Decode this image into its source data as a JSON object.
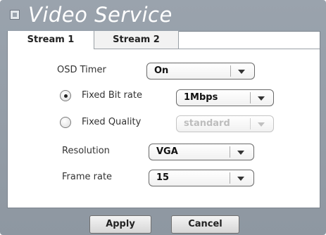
{
  "window": {
    "title": "Video Service"
  },
  "tabs": [
    {
      "label": "Stream 1",
      "active": true
    },
    {
      "label": "Stream 2",
      "active": false
    }
  ],
  "form": {
    "osd_timer": {
      "label": "OSD Timer",
      "value": "On"
    },
    "bitrate_mode": {
      "fixed_bit_rate": {
        "label": "Fixed Bit rate",
        "selected": true,
        "value": "1Mbps"
      },
      "fixed_quality": {
        "label": "Fixed Quality",
        "selected": false,
        "value": "standard",
        "disabled": true
      }
    },
    "resolution": {
      "label": "Resolution",
      "value": "VGA"
    },
    "frame_rate": {
      "label": "Frame rate",
      "value": "15"
    }
  },
  "buttons": {
    "apply": "Apply",
    "cancel": "Cancel"
  },
  "colors": {
    "panel": "#9aa3ad",
    "title_text": "#ffffff"
  }
}
